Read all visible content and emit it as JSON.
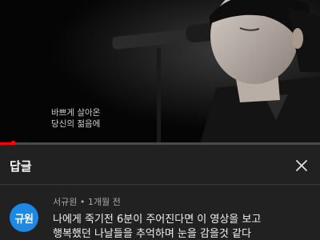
{
  "video": {
    "caption_lines": [
      "바쁘게 살아온",
      "당신의 젊음에"
    ],
    "progress": 0.04,
    "accent_color": "#ff0000"
  },
  "panel": {
    "title": "답글",
    "close_icon": "close-icon"
  },
  "comment": {
    "avatar_text": "규원",
    "avatar_color": "#1e88e5",
    "author": "서규원",
    "separator": "•",
    "time": "1개월 전",
    "lines": [
      "나에게 죽기전 6분이 주어진다면 이 영상을 보고",
      "행복했던 나날들을 추억하며 눈을 감을것 같다"
    ]
  }
}
